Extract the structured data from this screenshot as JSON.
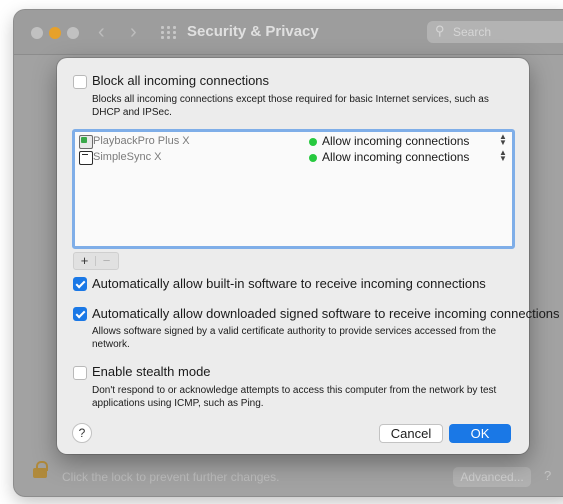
{
  "window": {
    "title": "Security & Privacy",
    "search_placeholder": "Search",
    "footer_text": "Click the lock to prevent further changes.",
    "advanced_label": "Advanced...",
    "help_label": "?"
  },
  "sheet": {
    "block_all": {
      "label": "Block all incoming connections",
      "checked": false,
      "description": "Blocks all incoming connections except those required for basic Internet services, such as DHCP and IPSec."
    },
    "apps": [
      {
        "name": "PlaybackPro Plus X",
        "icon": "playbackpro-app-icon",
        "status": "Allow incoming connections",
        "status_color": "#27c93f"
      },
      {
        "name": "SimpleSync X",
        "icon": "simplesync-app-icon",
        "status": "Allow incoming connections",
        "status_color": "#27c93f"
      }
    ],
    "add_label": "+",
    "remove_label": "−",
    "auto_builtin": {
      "label": "Automatically allow built-in software to receive incoming connections",
      "checked": true
    },
    "auto_signed": {
      "label": "Automatically allow downloaded signed software to receive incoming connections",
      "checked": true,
      "description": "Allows software signed by a valid certificate authority to provide services accessed from the network."
    },
    "stealth": {
      "label": "Enable stealth mode",
      "checked": false,
      "description": "Don't respond to or acknowledge attempts to access this computer from the network by test applications using ICMP, such as Ping."
    },
    "help_label": "?",
    "cancel_label": "Cancel",
    "ok_label": "OK"
  },
  "colors": {
    "accent": "#1a78e6",
    "allow_green": "#27c93f"
  }
}
